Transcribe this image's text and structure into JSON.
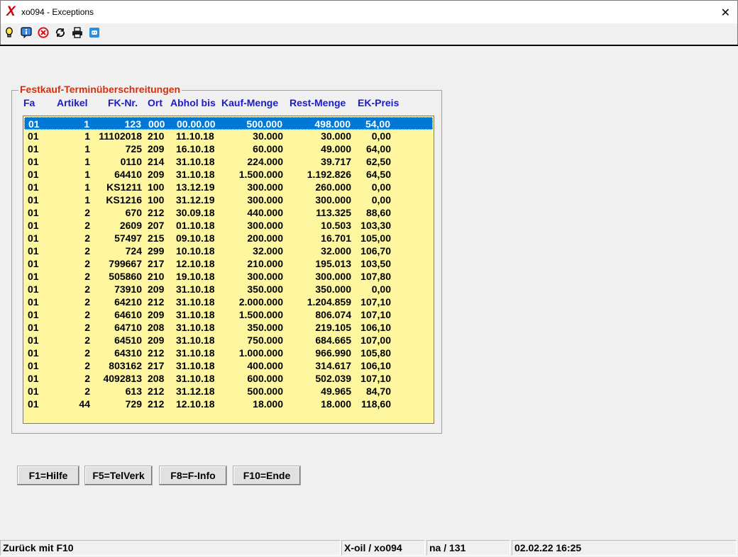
{
  "window": {
    "title": "xo094 - Exceptions",
    "close_glyph": "✕",
    "app_icon_glyph": "X"
  },
  "toolbar": {
    "icons": [
      {
        "name": "lightbulb-icon"
      },
      {
        "name": "info-icon"
      },
      {
        "name": "stop-icon"
      },
      {
        "name": "refresh-icon"
      },
      {
        "name": "printer-icon"
      },
      {
        "name": "chat-icon"
      }
    ]
  },
  "group": {
    "title": "Festkauf-Terminüberschreitungen",
    "headers": [
      "Fa",
      "Artikel",
      "FK-Nr.",
      "Ort",
      "Abhol bis",
      "Kauf-Menge",
      "Rest-Menge",
      "EK-Preis"
    ]
  },
  "rows": [
    [
      "01",
      "1",
      "123",
      "000",
      "00.00.00",
      "500.000",
      "498.000",
      "54,00"
    ],
    [
      "01",
      "1",
      "11102018",
      "210",
      "11.10.18",
      "30.000",
      "30.000",
      "0,00"
    ],
    [
      "01",
      "1",
      "725",
      "209",
      "16.10.18",
      "60.000",
      "49.000",
      "64,00"
    ],
    [
      "01",
      "1",
      "0110",
      "214",
      "31.10.18",
      "224.000",
      "39.717",
      "62,50"
    ],
    [
      "01",
      "1",
      "64410",
      "209",
      "31.10.18",
      "1.500.000",
      "1.192.826",
      "64,50"
    ],
    [
      "01",
      "1",
      "KS1211",
      "100",
      "13.12.19",
      "300.000",
      "260.000",
      "0,00"
    ],
    [
      "01",
      "1",
      "KS1216",
      "100",
      "31.12.19",
      "300.000",
      "300.000",
      "0,00"
    ],
    [
      "01",
      "2",
      "670",
      "212",
      "30.09.18",
      "440.000",
      "113.325",
      "88,60"
    ],
    [
      "01",
      "2",
      "2609",
      "207",
      "01.10.18",
      "300.000",
      "10.503",
      "103,30"
    ],
    [
      "01",
      "2",
      "57497",
      "215",
      "09.10.18",
      "200.000",
      "16.701",
      "105,00"
    ],
    [
      "01",
      "2",
      "724",
      "299",
      "10.10.18",
      "32.000",
      "32.000",
      "106,70"
    ],
    [
      "01",
      "2",
      "799667",
      "217",
      "12.10.18",
      "210.000",
      "195.013",
      "103,50"
    ],
    [
      "01",
      "2",
      "505860",
      "210",
      "19.10.18",
      "300.000",
      "300.000",
      "107,80"
    ],
    [
      "01",
      "2",
      "73910",
      "209",
      "31.10.18",
      "350.000",
      "350.000",
      "0,00"
    ],
    [
      "01",
      "2",
      "64210",
      "212",
      "31.10.18",
      "2.000.000",
      "1.204.859",
      "107,10"
    ],
    [
      "01",
      "2",
      "64610",
      "209",
      "31.10.18",
      "1.500.000",
      "806.074",
      "107,10"
    ],
    [
      "01",
      "2",
      "64710",
      "208",
      "31.10.18",
      "350.000",
      "219.105",
      "106,10"
    ],
    [
      "01",
      "2",
      "64510",
      "209",
      "31.10.18",
      "750.000",
      "684.665",
      "107,00"
    ],
    [
      "01",
      "2",
      "64310",
      "212",
      "31.10.18",
      "1.000.000",
      "966.990",
      "105,80"
    ],
    [
      "01",
      "2",
      "803162",
      "217",
      "31.10.18",
      "400.000",
      "314.617",
      "106,10"
    ],
    [
      "01",
      "2",
      "4092813",
      "208",
      "31.10.18",
      "600.000",
      "502.039",
      "107,10"
    ],
    [
      "01",
      "2",
      "613",
      "212",
      "31.12.18",
      "500.000",
      "49.965",
      "84,70"
    ],
    [
      "01",
      "44",
      "729",
      "212",
      "12.10.18",
      "18.000",
      "18.000",
      "118,60"
    ]
  ],
  "selected_row": 0,
  "buttons": [
    "F1=Hilfe",
    "F5=TelVerk",
    "F8=F-Info",
    "F10=Ende"
  ],
  "status": [
    "Zurück mit F10",
    "X-oil / xo094",
    "na / 131",
    "02.02.22 16:25"
  ],
  "colors": {
    "list_bg": "#fff79f",
    "selection": "#0078d7",
    "header_text": "#1a1ad0",
    "group_title": "#d03010"
  }
}
